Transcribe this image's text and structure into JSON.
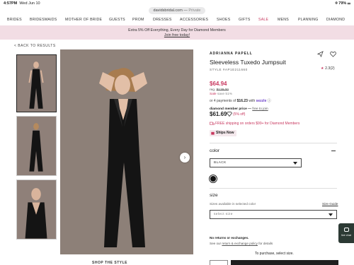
{
  "status_bar": {
    "time": "4:57PM",
    "date": "Wed Jun 10",
    "battery": "79%"
  },
  "browser": {
    "domain": "davidsbridal.com",
    "mode": "Private"
  },
  "nav": {
    "items": [
      "BRIDES",
      "BRIDESMAIDS",
      "MOTHER OF BRIDE",
      "GUESTS",
      "PROM",
      "DRESSES",
      "ACCESSORIES",
      "SHOES",
      "GIFTS",
      "SALE",
      "MENS",
      "PLANNING",
      "DIAMOND"
    ]
  },
  "promo": {
    "line1": "Extra 5% Off Everything, Every Day for Diamond Members",
    "line2": "Join free today!"
  },
  "back_link": "< BACK TO RESULTS",
  "gallery": {
    "shop_style": "SHOP THE STYLE"
  },
  "product": {
    "brand": "ADRIANNA PAPELL",
    "title": "Sleeveless Tuxedo Jumpsuit",
    "style": "STYLE #AP1E211660",
    "rating": "2.3(2)",
    "price": "$64.94",
    "reg_label": "reg.",
    "reg_price": "$139.00",
    "sale_label": "Sale",
    "save_text": "save 51%",
    "installments_pre": "or 4 payments of",
    "installments_amount": "$16.23",
    "installments_mid": "with",
    "sezzle": "sezzle",
    "diamond_label": "diamond member price —",
    "diamond_join": "free to join",
    "diamond_price": "$61.69",
    "diamond_off": "(5% off)",
    "free_shipping": "FREE shipping on orders $99+ for Diamond Members",
    "ships_now": "Ships Now"
  },
  "color": {
    "label": "color",
    "selected": "BLACK",
    "swatch_hex": "#111111"
  },
  "size": {
    "label": "size",
    "note": "Sizes available in selected color",
    "guide": "Size Guide",
    "placeholder": "select size"
  },
  "returns": {
    "title": "No returns or exchanges.",
    "pre": "See our",
    "link": "return & exchange policy",
    "post": "for details"
  },
  "purchase_note": "To purchase, select size.",
  "live_chat": "live chat",
  "colors": {
    "accent": "#c8385f",
    "promo_bg": "#f2dde4",
    "dark": "#1f1f1f"
  }
}
